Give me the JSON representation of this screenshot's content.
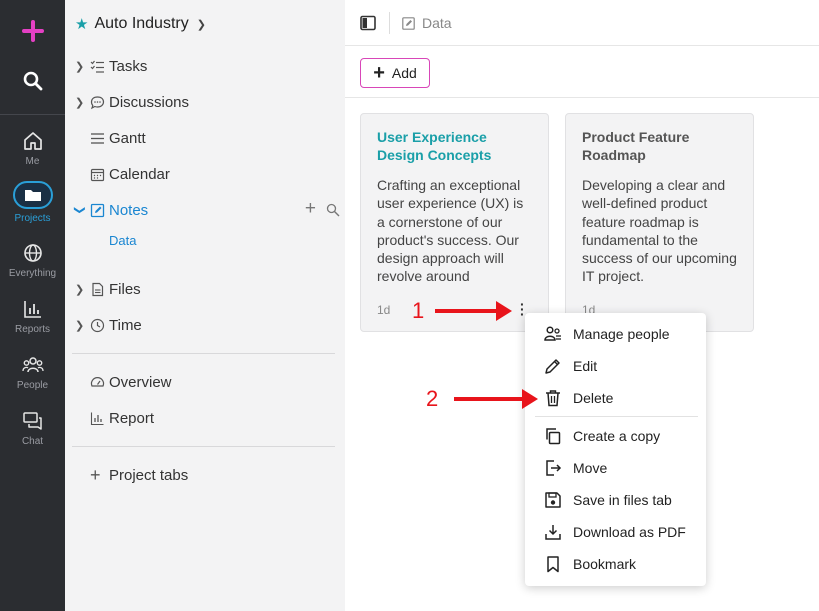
{
  "rail": {
    "items": [
      {
        "label": "Me",
        "icon": "home-icon"
      },
      {
        "label": "Projects",
        "icon": "folder-icon"
      },
      {
        "label": "Everything",
        "icon": "globe-icon"
      },
      {
        "label": "Reports",
        "icon": "bar-chart-icon"
      },
      {
        "label": "People",
        "icon": "people-icon"
      },
      {
        "label": "Chat",
        "icon": "chat-icon"
      }
    ]
  },
  "sidebar": {
    "project_title": "Auto Industry",
    "items": [
      {
        "label": "Tasks"
      },
      {
        "label": "Discussions"
      },
      {
        "label": "Gantt"
      },
      {
        "label": "Calendar"
      },
      {
        "label": "Notes"
      },
      {
        "label": "Files"
      },
      {
        "label": "Time"
      },
      {
        "label": "Overview"
      },
      {
        "label": "Report"
      },
      {
        "label": "Project tabs"
      }
    ],
    "notes_sub": "Data"
  },
  "topbar": {
    "breadcrumb": "Data"
  },
  "actionbar": {
    "add_label": "Add"
  },
  "cards": [
    {
      "title": "User Experience Design Concepts",
      "text": "Crafting an exceptional user experience (UX) is a cornerstone of our product's success. Our design approach will revolve around",
      "time": "1d"
    },
    {
      "title": "Product Feature Roadmap",
      "text": "Developing a clear and well-defined product feature roadmap is fundamental to the success of our upcoming IT project.",
      "time": "1d"
    }
  ],
  "menu": {
    "items": [
      {
        "label": "Manage people",
        "icon": "manage-people-icon"
      },
      {
        "label": "Edit",
        "icon": "pencil-icon"
      },
      {
        "label": "Delete",
        "icon": "trash-icon"
      },
      {
        "label": "Create a copy",
        "icon": "copy-icon"
      },
      {
        "label": "Move",
        "icon": "move-icon"
      },
      {
        "label": "Save in files tab",
        "icon": "save-icon"
      },
      {
        "label": "Download as PDF",
        "icon": "download-icon"
      },
      {
        "label": "Bookmark",
        "icon": "bookmark-icon"
      }
    ]
  },
  "annotations": [
    "1",
    "2"
  ],
  "colors": {
    "accent": "#1a86d1",
    "title_teal": "#1a9fa8",
    "add_border": "#d846b8",
    "plus_pink": "#e540c4",
    "annotation_red": "#e8141b",
    "rail_bg": "#2b2d31"
  }
}
